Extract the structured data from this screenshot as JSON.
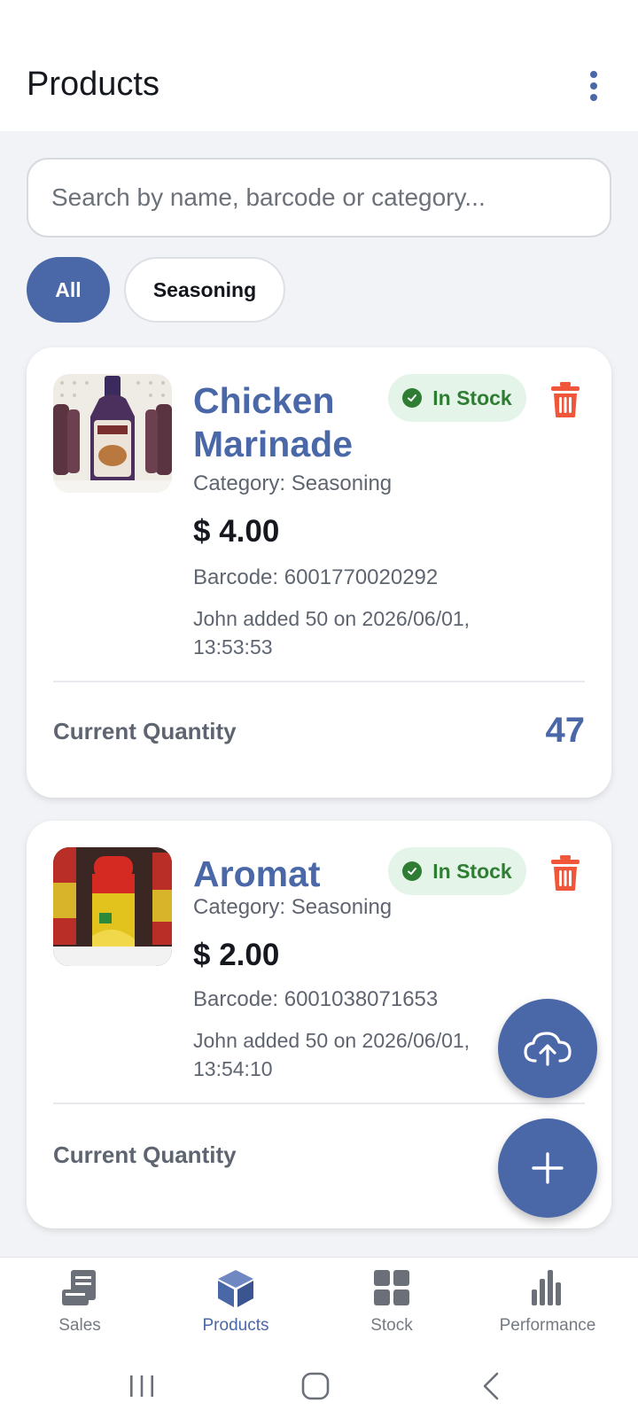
{
  "header": {
    "title": "Products"
  },
  "search": {
    "placeholder": "Search by name, barcode or category..."
  },
  "filters": [
    {
      "label": "All",
      "selected": true
    },
    {
      "label": "Seasoning",
      "selected": false
    }
  ],
  "products": [
    {
      "name": "Chicken Marinade",
      "status": "In Stock",
      "category": "Category: Seasoning",
      "price": "$ 4.00",
      "barcode": "Barcode: 6001770020292",
      "added": "John added 50 on 2026/06/01, 13:53:53",
      "quantity_label": "Current Quantity",
      "quantity": "47"
    },
    {
      "name": "Aromat",
      "status": "In Stock",
      "category": "Category: Seasoning",
      "price": "$ 2.00",
      "barcode": "Barcode: 6001038071653",
      "added": "John added 50 on 2026/06/01, 13:54:10",
      "quantity_label": "Current Quantity",
      "quantity": ""
    }
  ],
  "bottom_nav": [
    {
      "label": "Sales",
      "icon": "receipt-icon",
      "active": false
    },
    {
      "label": "Products",
      "icon": "cube-icon",
      "active": true
    },
    {
      "label": "Stock",
      "icon": "grid-icon",
      "active": false
    },
    {
      "label": "Performance",
      "icon": "bar-chart-icon",
      "active": false
    }
  ],
  "colors": {
    "primary": "#4a67a8",
    "success": "#2e7d32",
    "success_bg": "#e5f4e9",
    "danger": "#f0563a",
    "background": "#f1f3f6"
  }
}
